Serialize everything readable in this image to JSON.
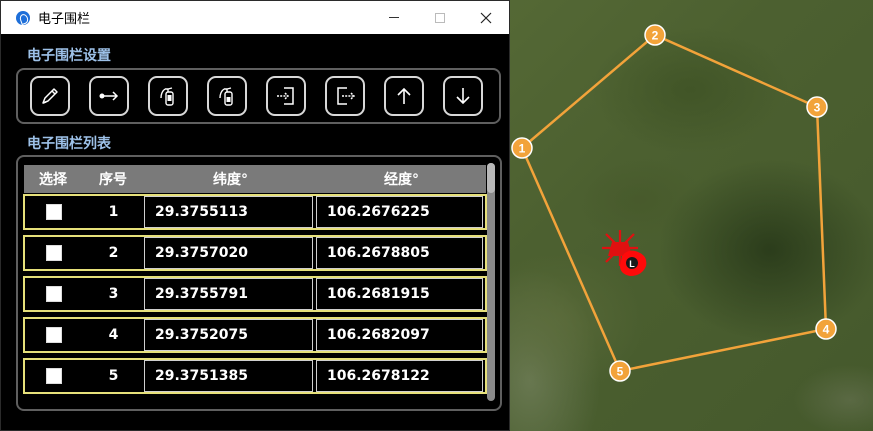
{
  "window": {
    "title": "电子围栏",
    "controls": {
      "minimize": "—",
      "maximize": "☐",
      "close": "✕"
    }
  },
  "settings": {
    "title": "电子围栏设置",
    "tools": [
      {
        "name": "edit-pen-icon"
      },
      {
        "name": "add-point-arrow-icon"
      },
      {
        "name": "fire-extinguisher-icon"
      },
      {
        "name": "fire-extinguisher-outline-icon"
      },
      {
        "name": "import-icon"
      },
      {
        "name": "export-icon"
      },
      {
        "name": "arrow-up-icon"
      },
      {
        "name": "arrow-down-icon"
      }
    ]
  },
  "list": {
    "title": "电子围栏列表",
    "columns": [
      "选择",
      "序号",
      "纬度°",
      "经度°"
    ],
    "rows": [
      {
        "index": "1",
        "lat": "29.3755113",
        "lon": "106.2676225"
      },
      {
        "index": "2",
        "lat": "29.3757020",
        "lon": "106.2678805"
      },
      {
        "index": "3",
        "lat": "29.3755791",
        "lon": "106.2681915"
      },
      {
        "index": "4",
        "lat": "29.3752075",
        "lon": "106.2682097"
      },
      {
        "index": "5",
        "lat": "29.3751385",
        "lon": "106.2678122"
      }
    ]
  },
  "map": {
    "fence_color": "#f2a33a",
    "vertices": [
      "1",
      "2",
      "3",
      "4",
      "5"
    ],
    "home_marker": "L"
  }
}
